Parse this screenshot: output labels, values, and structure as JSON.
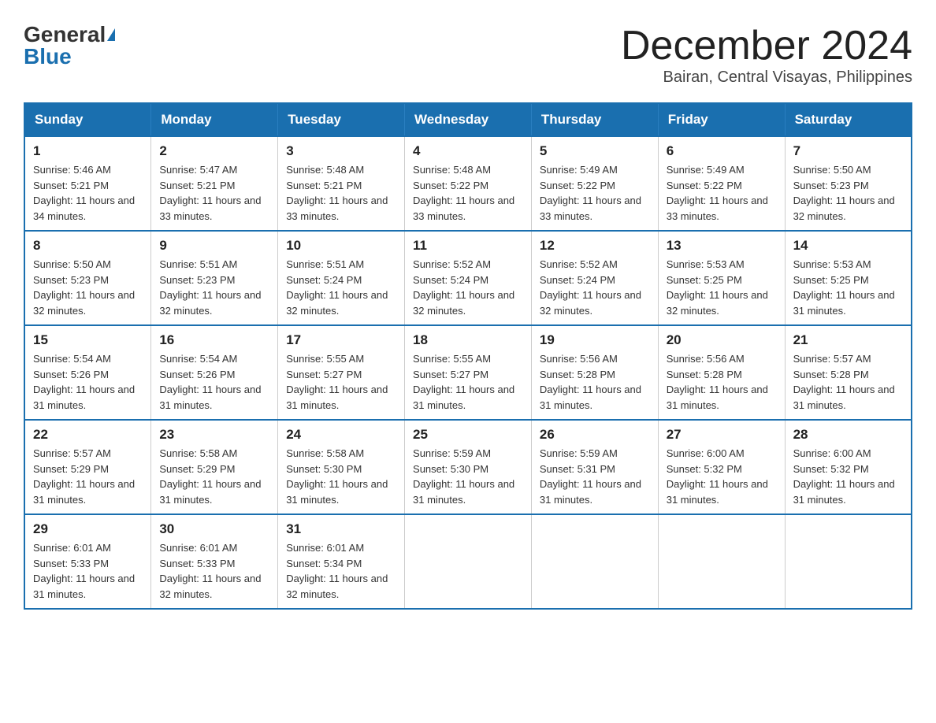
{
  "logo": {
    "general": "General",
    "blue": "Blue"
  },
  "title": "December 2024",
  "location": "Bairan, Central Visayas, Philippines",
  "days_of_week": [
    "Sunday",
    "Monday",
    "Tuesday",
    "Wednesday",
    "Thursday",
    "Friday",
    "Saturday"
  ],
  "weeks": [
    [
      {
        "day": "1",
        "sunrise": "5:46 AM",
        "sunset": "5:21 PM",
        "daylight": "11 hours and 34 minutes."
      },
      {
        "day": "2",
        "sunrise": "5:47 AM",
        "sunset": "5:21 PM",
        "daylight": "11 hours and 33 minutes."
      },
      {
        "day": "3",
        "sunrise": "5:48 AM",
        "sunset": "5:21 PM",
        "daylight": "11 hours and 33 minutes."
      },
      {
        "day": "4",
        "sunrise": "5:48 AM",
        "sunset": "5:22 PM",
        "daylight": "11 hours and 33 minutes."
      },
      {
        "day": "5",
        "sunrise": "5:49 AM",
        "sunset": "5:22 PM",
        "daylight": "11 hours and 33 minutes."
      },
      {
        "day": "6",
        "sunrise": "5:49 AM",
        "sunset": "5:22 PM",
        "daylight": "11 hours and 33 minutes."
      },
      {
        "day": "7",
        "sunrise": "5:50 AM",
        "sunset": "5:23 PM",
        "daylight": "11 hours and 32 minutes."
      }
    ],
    [
      {
        "day": "8",
        "sunrise": "5:50 AM",
        "sunset": "5:23 PM",
        "daylight": "11 hours and 32 minutes."
      },
      {
        "day": "9",
        "sunrise": "5:51 AM",
        "sunset": "5:23 PM",
        "daylight": "11 hours and 32 minutes."
      },
      {
        "day": "10",
        "sunrise": "5:51 AM",
        "sunset": "5:24 PM",
        "daylight": "11 hours and 32 minutes."
      },
      {
        "day": "11",
        "sunrise": "5:52 AM",
        "sunset": "5:24 PM",
        "daylight": "11 hours and 32 minutes."
      },
      {
        "day": "12",
        "sunrise": "5:52 AM",
        "sunset": "5:24 PM",
        "daylight": "11 hours and 32 minutes."
      },
      {
        "day": "13",
        "sunrise": "5:53 AM",
        "sunset": "5:25 PM",
        "daylight": "11 hours and 32 minutes."
      },
      {
        "day": "14",
        "sunrise": "5:53 AM",
        "sunset": "5:25 PM",
        "daylight": "11 hours and 31 minutes."
      }
    ],
    [
      {
        "day": "15",
        "sunrise": "5:54 AM",
        "sunset": "5:26 PM",
        "daylight": "11 hours and 31 minutes."
      },
      {
        "day": "16",
        "sunrise": "5:54 AM",
        "sunset": "5:26 PM",
        "daylight": "11 hours and 31 minutes."
      },
      {
        "day": "17",
        "sunrise": "5:55 AM",
        "sunset": "5:27 PM",
        "daylight": "11 hours and 31 minutes."
      },
      {
        "day": "18",
        "sunrise": "5:55 AM",
        "sunset": "5:27 PM",
        "daylight": "11 hours and 31 minutes."
      },
      {
        "day": "19",
        "sunrise": "5:56 AM",
        "sunset": "5:28 PM",
        "daylight": "11 hours and 31 minutes."
      },
      {
        "day": "20",
        "sunrise": "5:56 AM",
        "sunset": "5:28 PM",
        "daylight": "11 hours and 31 minutes."
      },
      {
        "day": "21",
        "sunrise": "5:57 AM",
        "sunset": "5:28 PM",
        "daylight": "11 hours and 31 minutes."
      }
    ],
    [
      {
        "day": "22",
        "sunrise": "5:57 AM",
        "sunset": "5:29 PM",
        "daylight": "11 hours and 31 minutes."
      },
      {
        "day": "23",
        "sunrise": "5:58 AM",
        "sunset": "5:29 PM",
        "daylight": "11 hours and 31 minutes."
      },
      {
        "day": "24",
        "sunrise": "5:58 AM",
        "sunset": "5:30 PM",
        "daylight": "11 hours and 31 minutes."
      },
      {
        "day": "25",
        "sunrise": "5:59 AM",
        "sunset": "5:30 PM",
        "daylight": "11 hours and 31 minutes."
      },
      {
        "day": "26",
        "sunrise": "5:59 AM",
        "sunset": "5:31 PM",
        "daylight": "11 hours and 31 minutes."
      },
      {
        "day": "27",
        "sunrise": "6:00 AM",
        "sunset": "5:32 PM",
        "daylight": "11 hours and 31 minutes."
      },
      {
        "day": "28",
        "sunrise": "6:00 AM",
        "sunset": "5:32 PM",
        "daylight": "11 hours and 31 minutes."
      }
    ],
    [
      {
        "day": "29",
        "sunrise": "6:01 AM",
        "sunset": "5:33 PM",
        "daylight": "11 hours and 31 minutes."
      },
      {
        "day": "30",
        "sunrise": "6:01 AM",
        "sunset": "5:33 PM",
        "daylight": "11 hours and 32 minutes."
      },
      {
        "day": "31",
        "sunrise": "6:01 AM",
        "sunset": "5:34 PM",
        "daylight": "11 hours and 32 minutes."
      },
      null,
      null,
      null,
      null
    ]
  ]
}
